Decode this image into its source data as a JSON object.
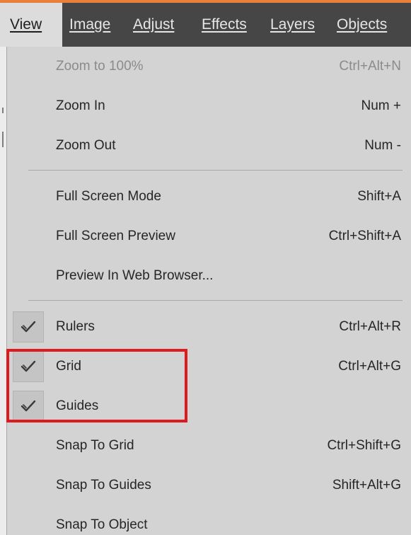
{
  "menubar": {
    "items": [
      {
        "label": "View"
      },
      {
        "label": "Image"
      },
      {
        "label": "Adjust"
      },
      {
        "label": "Effects"
      },
      {
        "label": "Layers"
      },
      {
        "label": "Objects"
      }
    ]
  },
  "view_menu": {
    "items": [
      {
        "label": "Zoom to 100%",
        "shortcut": "Ctrl+Alt+N",
        "enabled": false,
        "checked": false
      },
      {
        "label": "Zoom In",
        "shortcut": "Num +",
        "enabled": true,
        "checked": false
      },
      {
        "label": "Zoom Out",
        "shortcut": "Num -",
        "enabled": true,
        "checked": false
      },
      {
        "label": "Full Screen Mode",
        "shortcut": "Shift+A",
        "enabled": true,
        "checked": false
      },
      {
        "label": "Full Screen Preview",
        "shortcut": "Ctrl+Shift+A",
        "enabled": true,
        "checked": false
      },
      {
        "label": "Preview In Web Browser...",
        "shortcut": "",
        "enabled": true,
        "checked": false
      },
      {
        "label": "Rulers",
        "shortcut": "Ctrl+Alt+R",
        "enabled": true,
        "checked": true
      },
      {
        "label": "Grid",
        "shortcut": "Ctrl+Alt+G",
        "enabled": true,
        "checked": true
      },
      {
        "label": "Guides",
        "shortcut": "",
        "enabled": true,
        "checked": true
      },
      {
        "label": "Snap To Grid",
        "shortcut": "Ctrl+Shift+G",
        "enabled": true,
        "checked": false
      },
      {
        "label": "Snap To Guides",
        "shortcut": "Shift+Alt+G",
        "enabled": true,
        "checked": false
      },
      {
        "label": "Snap To Object",
        "shortcut": "",
        "enabled": true,
        "checked": false
      }
    ]
  },
  "colors": {
    "accent": "#e8803a",
    "menubar_bg": "#464646",
    "menu_bg": "#d3d3d3",
    "annotation": "#e0191e"
  }
}
